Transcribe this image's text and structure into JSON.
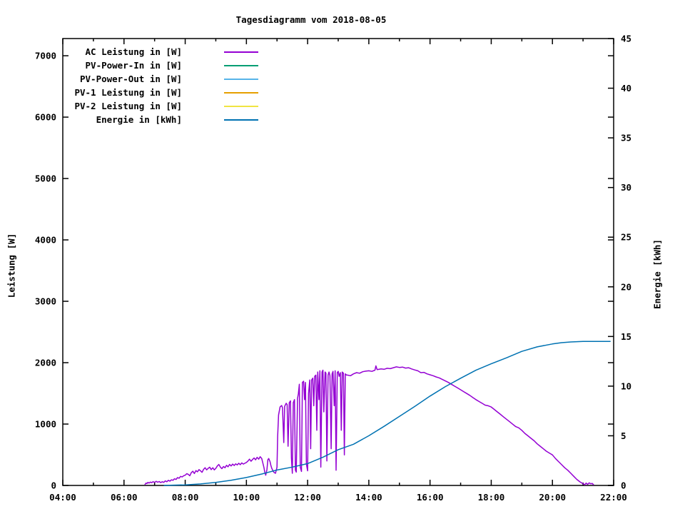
{
  "chart_data": {
    "type": "line",
    "title": "Tagesdiagramm vom 2018-08-05",
    "background_color": "#ffffff",
    "border_color": "#000000",
    "grid": false,
    "legend_position": "top-left-inside",
    "x_axis": {
      "lim": [
        4,
        22
      ],
      "major_step_hours": 2,
      "minor_step_hours": 1,
      "tick_labels": [
        "04:00",
        "06:00",
        "08:00",
        "10:00",
        "12:00",
        "14:00",
        "16:00",
        "18:00",
        "20:00",
        "22:00"
      ]
    },
    "y_axis": {
      "label": "Leistung [W]",
      "lim": [
        0,
        7280
      ],
      "ticks": [
        0,
        1000,
        2000,
        3000,
        4000,
        5000,
        6000,
        7000
      ]
    },
    "y2_axis": {
      "label": "Energie [kWh]",
      "lim": [
        0,
        45
      ],
      "ticks": [
        0,
        5,
        10,
        15,
        20,
        25,
        30,
        35,
        40,
        45
      ]
    },
    "series": [
      {
        "name": "AC Leistung in [W]",
        "color": "#9400d3",
        "axis": "y1",
        "points": [
          [
            6.68,
            10
          ],
          [
            6.72,
            40
          ],
          [
            6.75,
            30
          ],
          [
            6.78,
            50
          ],
          [
            6.82,
            38
          ],
          [
            6.86,
            55
          ],
          [
            6.9,
            45
          ],
          [
            6.95,
            60
          ],
          [
            7.0,
            50
          ],
          [
            7.05,
            68
          ],
          [
            7.1,
            52
          ],
          [
            7.15,
            64
          ],
          [
            7.2,
            46
          ],
          [
            7.25,
            60
          ],
          [
            7.3,
            50
          ],
          [
            7.35,
            74
          ],
          [
            7.4,
            60
          ],
          [
            7.45,
            84
          ],
          [
            7.5,
            70
          ],
          [
            7.55,
            92
          ],
          [
            7.6,
            84
          ],
          [
            7.65,
            108
          ],
          [
            7.7,
            98
          ],
          [
            7.75,
            128
          ],
          [
            7.8,
            118
          ],
          [
            7.85,
            148
          ],
          [
            7.9,
            138
          ],
          [
            7.95,
            158
          ],
          [
            8.0,
            168
          ],
          [
            8.05,
            192
          ],
          [
            8.1,
            182
          ],
          [
            8.15,
            158
          ],
          [
            8.2,
            208
          ],
          [
            8.25,
            232
          ],
          [
            8.3,
            194
          ],
          [
            8.35,
            242
          ],
          [
            8.4,
            222
          ],
          [
            8.45,
            258
          ],
          [
            8.5,
            238
          ],
          [
            8.55,
            214
          ],
          [
            8.6,
            262
          ],
          [
            8.65,
            288
          ],
          [
            8.7,
            254
          ],
          [
            8.75,
            278
          ],
          [
            8.8,
            298
          ],
          [
            8.85,
            258
          ],
          [
            8.9,
            288
          ],
          [
            8.95,
            254
          ],
          [
            9.0,
            278
          ],
          [
            9.05,
            318
          ],
          [
            9.1,
            342
          ],
          [
            9.15,
            298
          ],
          [
            9.2,
            274
          ],
          [
            9.25,
            308
          ],
          [
            9.3,
            288
          ],
          [
            9.35,
            328
          ],
          [
            9.4,
            304
          ],
          [
            9.45,
            342
          ],
          [
            9.5,
            318
          ],
          [
            9.55,
            348
          ],
          [
            9.6,
            324
          ],
          [
            9.65,
            352
          ],
          [
            9.7,
            334
          ],
          [
            9.75,
            362
          ],
          [
            9.8,
            338
          ],
          [
            9.85,
            368
          ],
          [
            9.9,
            348
          ],
          [
            9.95,
            362
          ],
          [
            10.0,
            374
          ],
          [
            10.05,
            398
          ],
          [
            10.1,
            428
          ],
          [
            10.15,
            394
          ],
          [
            10.2,
            422
          ],
          [
            10.25,
            448
          ],
          [
            10.3,
            418
          ],
          [
            10.35,
            458
          ],
          [
            10.4,
            428
          ],
          [
            10.45,
            468
          ],
          [
            10.5,
            438
          ],
          [
            10.53,
            378
          ],
          [
            10.57,
            298
          ],
          [
            10.6,
            218
          ],
          [
            10.63,
            168
          ],
          [
            10.67,
            258
          ],
          [
            10.7,
            418
          ],
          [
            10.73,
            438
          ],
          [
            10.77,
            388
          ],
          [
            10.8,
            328
          ],
          [
            10.83,
            278
          ],
          [
            10.87,
            238
          ],
          [
            10.9,
            214
          ],
          [
            10.95,
            198
          ],
          [
            11.0,
            298
          ],
          [
            11.02,
            792
          ],
          [
            11.05,
            1148
          ],
          [
            11.1,
            1278
          ],
          [
            11.15,
            1302
          ],
          [
            11.18,
            1268
          ],
          [
            11.22,
            698
          ],
          [
            11.25,
            1288
          ],
          [
            11.3,
            1338
          ],
          [
            11.33,
            1318
          ],
          [
            11.36,
            638
          ],
          [
            11.4,
            1348
          ],
          [
            11.44,
            1378
          ],
          [
            11.47,
            448
          ],
          [
            11.5,
            198
          ],
          [
            11.53,
            1348
          ],
          [
            11.57,
            1398
          ],
          [
            11.6,
            248
          ],
          [
            11.63,
            218
          ],
          [
            11.67,
            1418
          ],
          [
            11.7,
            1498
          ],
          [
            11.73,
            1648
          ],
          [
            11.76,
            298
          ],
          [
            11.8,
            228
          ],
          [
            11.83,
            1678
          ],
          [
            11.87,
            1698
          ],
          [
            11.9,
            1398
          ],
          [
            11.93,
            1678
          ],
          [
            11.96,
            348
          ],
          [
            12.0,
            238
          ],
          [
            12.03,
            1498
          ],
          [
            12.07,
            1718
          ],
          [
            12.1,
            598
          ],
          [
            12.13,
            1718
          ],
          [
            12.17,
            1748
          ],
          [
            12.2,
            1298
          ],
          [
            12.23,
            1778
          ],
          [
            12.27,
            1798
          ],
          [
            12.3,
            898
          ],
          [
            12.33,
            1848
          ],
          [
            12.37,
            1398
          ],
          [
            12.4,
            1868
          ],
          [
            12.43,
            298
          ],
          [
            12.47,
            1848
          ],
          [
            12.5,
            1878
          ],
          [
            12.53,
            1198
          ],
          [
            12.57,
            1848
          ],
          [
            12.6,
            1828
          ],
          [
            12.63,
            398
          ],
          [
            12.67,
            1798
          ],
          [
            12.7,
            1848
          ],
          [
            12.73,
            1788
          ],
          [
            12.77,
            598
          ],
          [
            12.8,
            1818
          ],
          [
            12.83,
            1858
          ],
          [
            12.87,
            1298
          ],
          [
            12.9,
            1868
          ],
          [
            12.93,
            248
          ],
          [
            12.97,
            1838
          ],
          [
            13.0,
            1858
          ],
          [
            13.03,
            1778
          ],
          [
            13.07,
            1838
          ],
          [
            13.1,
            898
          ],
          [
            13.13,
            1848
          ],
          [
            13.17,
            1828
          ],
          [
            13.2,
            498
          ],
          [
            13.23,
            1818
          ],
          [
            13.27,
            1798
          ],
          [
            13.3,
            1798
          ],
          [
            13.4,
            1788
          ],
          [
            13.5,
            1818
          ],
          [
            13.6,
            1838
          ],
          [
            13.7,
            1828
          ],
          [
            13.8,
            1852
          ],
          [
            13.9,
            1862
          ],
          [
            14.0,
            1868
          ],
          [
            14.1,
            1858
          ],
          [
            14.2,
            1878
          ],
          [
            14.23,
            1948
          ],
          [
            14.27,
            1888
          ],
          [
            14.4,
            1898
          ],
          [
            14.5,
            1892
          ],
          [
            14.6,
            1908
          ],
          [
            14.7,
            1902
          ],
          [
            14.8,
            1918
          ],
          [
            14.9,
            1932
          ],
          [
            15.0,
            1922
          ],
          [
            15.1,
            1928
          ],
          [
            15.2,
            1912
          ],
          [
            15.3,
            1918
          ],
          [
            15.4,
            1898
          ],
          [
            15.5,
            1882
          ],
          [
            15.6,
            1868
          ],
          [
            15.7,
            1838
          ],
          [
            15.8,
            1842
          ],
          [
            15.9,
            1818
          ],
          [
            16.0,
            1802
          ],
          [
            16.1,
            1788
          ],
          [
            16.2,
            1768
          ],
          [
            16.3,
            1752
          ],
          [
            16.4,
            1728
          ],
          [
            16.5,
            1702
          ],
          [
            16.6,
            1678
          ],
          [
            16.7,
            1648
          ],
          [
            16.8,
            1618
          ],
          [
            16.9,
            1588
          ],
          [
            17.0,
            1558
          ],
          [
            17.1,
            1528
          ],
          [
            17.2,
            1498
          ],
          [
            17.3,
            1468
          ],
          [
            17.4,
            1432
          ],
          [
            17.5,
            1398
          ],
          [
            17.6,
            1368
          ],
          [
            17.7,
            1338
          ],
          [
            17.8,
            1308
          ],
          [
            17.9,
            1298
          ],
          [
            18.0,
            1278
          ],
          [
            18.1,
            1238
          ],
          [
            18.2,
            1198
          ],
          [
            18.3,
            1158
          ],
          [
            18.4,
            1118
          ],
          [
            18.5,
            1078
          ],
          [
            18.6,
            1038
          ],
          [
            18.7,
            998
          ],
          [
            18.8,
            958
          ],
          [
            18.9,
            938
          ],
          [
            19.0,
            898
          ],
          [
            19.1,
            848
          ],
          [
            19.2,
            808
          ],
          [
            19.3,
            768
          ],
          [
            19.4,
            728
          ],
          [
            19.5,
            678
          ],
          [
            19.6,
            638
          ],
          [
            19.7,
            598
          ],
          [
            19.8,
            558
          ],
          [
            19.9,
            528
          ],
          [
            20.0,
            498
          ],
          [
            20.1,
            438
          ],
          [
            20.2,
            388
          ],
          [
            20.3,
            338
          ],
          [
            20.4,
            288
          ],
          [
            20.5,
            248
          ],
          [
            20.6,
            198
          ],
          [
            20.7,
            148
          ],
          [
            20.8,
            98
          ],
          [
            20.9,
            58
          ],
          [
            21.0,
            28
          ],
          [
            21.05,
            12
          ],
          [
            21.1,
            38
          ],
          [
            21.15,
            18
          ],
          [
            21.2,
            42
          ],
          [
            21.25,
            28
          ],
          [
            21.3,
            32
          ],
          [
            21.35,
            8
          ]
        ]
      },
      {
        "name": "PV-Power-In in [W]",
        "color": "#009e73",
        "axis": "y1",
        "points": []
      },
      {
        "name": "PV-Power-Out in [W]",
        "color": "#56b4e9",
        "axis": "y1",
        "points": []
      },
      {
        "name": "PV-1 Leistung in [W]",
        "color": "#e69f00",
        "axis": "y1",
        "points": []
      },
      {
        "name": "PV-2 Leistung in [W]",
        "color": "#f0e442",
        "axis": "y1",
        "points": []
      },
      {
        "name": "Energie in [kWh]",
        "color": "#0072b2",
        "axis": "y2",
        "points": [
          [
            7.3,
            0
          ],
          [
            7.5,
            0.02
          ],
          [
            8.0,
            0.06
          ],
          [
            8.5,
            0.15
          ],
          [
            9.0,
            0.3
          ],
          [
            9.5,
            0.52
          ],
          [
            10.0,
            0.8
          ],
          [
            10.5,
            1.15
          ],
          [
            11.0,
            1.55
          ],
          [
            11.5,
            1.85
          ],
          [
            12.0,
            2.2
          ],
          [
            12.5,
            2.85
          ],
          [
            13.0,
            3.6
          ],
          [
            13.5,
            4.15
          ],
          [
            14.0,
            5.0
          ],
          [
            14.5,
            5.95
          ],
          [
            15.0,
            6.95
          ],
          [
            15.5,
            7.95
          ],
          [
            16.0,
            9.0
          ],
          [
            16.5,
            9.95
          ],
          [
            17.0,
            10.8
          ],
          [
            17.5,
            11.6
          ],
          [
            18.0,
            12.25
          ],
          [
            18.5,
            12.85
          ],
          [
            19.0,
            13.5
          ],
          [
            19.5,
            13.95
          ],
          [
            20.0,
            14.25
          ],
          [
            20.3,
            14.38
          ],
          [
            20.6,
            14.45
          ],
          [
            21.0,
            14.5
          ],
          [
            21.5,
            14.5
          ],
          [
            21.9,
            14.5
          ]
        ]
      }
    ]
  }
}
